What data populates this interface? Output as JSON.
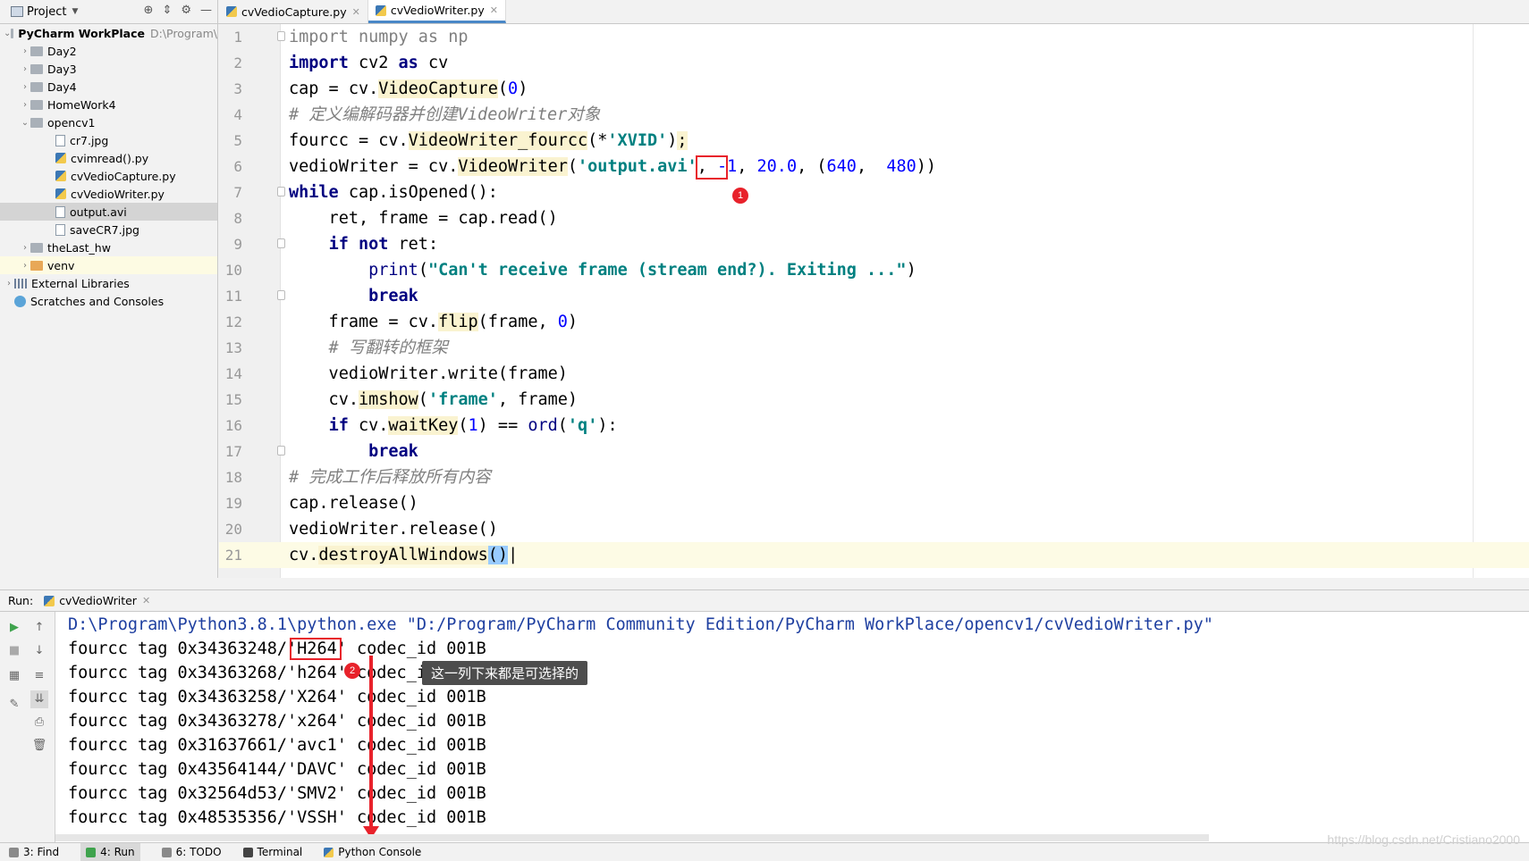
{
  "project_header": {
    "label": "Project"
  },
  "tabs": [
    {
      "label": "cvVedioCapture.py"
    },
    {
      "label": "cvVedioWriter.py"
    }
  ],
  "tree": {
    "root": {
      "name": "PyCharm WorkPlace",
      "path": "D:\\Program\\"
    },
    "items": [
      {
        "label": "Day2"
      },
      {
        "label": "Day3"
      },
      {
        "label": "Day4"
      },
      {
        "label": "HomeWork4"
      },
      {
        "label": "opencv1"
      },
      {
        "label": "cr7.jpg"
      },
      {
        "label": "cvimread().py"
      },
      {
        "label": "cvVedioCapture.py"
      },
      {
        "label": "cvVedioWriter.py"
      },
      {
        "label": "output.avi"
      },
      {
        "label": "saveCR7.jpg"
      },
      {
        "label": "theLast_hw"
      },
      {
        "label": "venv"
      },
      {
        "label": "External Libraries"
      },
      {
        "label": "Scratches and Consoles"
      }
    ]
  },
  "editor": {
    "line_numbers": [
      "1",
      "2",
      "3",
      "4",
      "5",
      "6",
      "7",
      "8",
      "9",
      "10",
      "11",
      "12",
      "13",
      "14",
      "15",
      "16",
      "17",
      "18",
      "19",
      "20",
      "21"
    ],
    "annotation_badge_1": "1"
  },
  "run": {
    "label": "Run:",
    "tab": "cvVedioWriter",
    "command": "D:\\Program\\Python3.8.1\\python.exe \"D:/Program/PyCharm Community Edition/PyCharm WorkPlace/opencv1/cvVedioWriter.py\"",
    "output": [
      "fourcc tag 0x34363248/'H264' codec_id 001B",
      "fourcc tag 0x34363268/'h264' codec_id 001B",
      "fourcc tag 0x34363258/'X264' codec_id 001B",
      "fourcc tag 0x34363278/'x264' codec_id 001B",
      "fourcc tag 0x31637661/'avc1' codec_id 001B",
      "fourcc tag 0x43564144/'DAVC' codec_id 001B",
      "fourcc tag 0x32564d53/'SMV2' codec_id 001B",
      "fourcc tag 0x48535356/'VSSH' codec_id 001B"
    ],
    "annotation_badge_2": "2",
    "tooltip": "这一列下来都是可选择的"
  },
  "statusbar": {
    "items": [
      {
        "label": "3: Find"
      },
      {
        "label": "4: Run"
      },
      {
        "label": "6: TODO"
      },
      {
        "label": "Terminal"
      },
      {
        "label": "Python Console"
      }
    ]
  },
  "watermark": "https://blog.csdn.net/Cristiano2000",
  "colors": {
    "keyword": "#000080",
    "string": "#008080",
    "number": "#0000ff",
    "comment": "#808080",
    "annotation_red": "#e8222b",
    "tab_underline": "#4a88c7"
  }
}
